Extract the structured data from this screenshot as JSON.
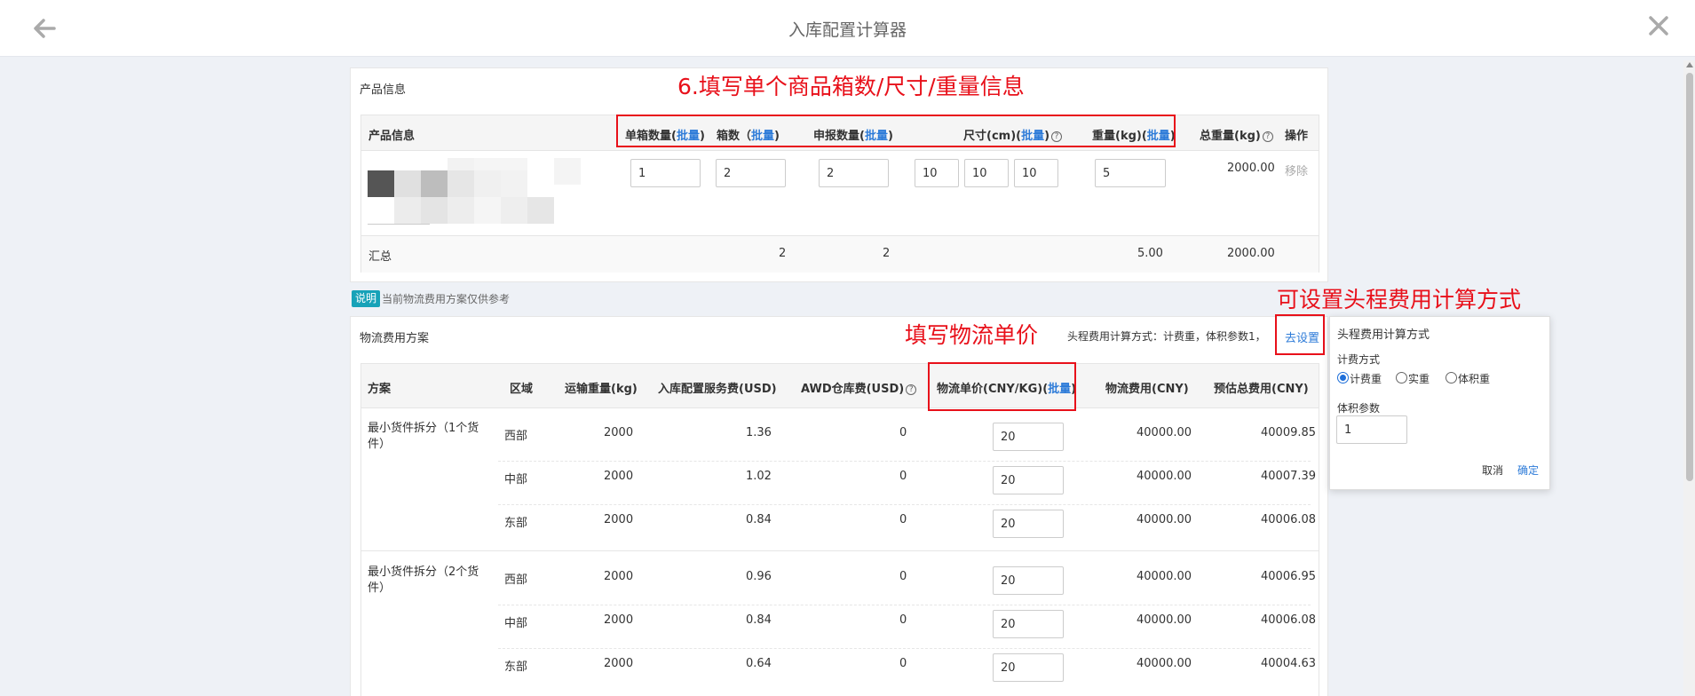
{
  "header": {
    "title": "入库配置计算器"
  },
  "product": {
    "panel_title": "产品信息",
    "columns": {
      "product_info": "产品信息",
      "per_box_qty": "单箱数量(",
      "box_count": "箱数（",
      "declared_qty": "申报数量(",
      "size": "尺寸(cm)(",
      "weight": "重量(kg)(",
      "total_weight": "总重量(kg)",
      "action": "操作",
      "batch": "批量",
      "close_paren": ")"
    },
    "row": {
      "per_box_qty": "1",
      "box_count": "2",
      "declared_qty": "2",
      "length": "10",
      "width": "10",
      "height": "10",
      "weight": "5",
      "total_weight": "2000.00",
      "remove": "移除"
    },
    "summary": {
      "label": "汇总",
      "box_count": "2",
      "declared_qty": "2",
      "weight": "5.00",
      "total_weight": "2000.00"
    }
  },
  "notice": {
    "badge": "说明",
    "text": "当前物流费用方案仅供参考"
  },
  "logistics": {
    "panel_title": "物流费用方案",
    "calc_method_text": "头程费用计算方式：计费重，体积参数1，",
    "settings_link": "去设置",
    "columns": {
      "plan": "方案",
      "region": "区域",
      "ship_weight": "运输重量(kg)",
      "service_fee": "入库配置服务费(USD)",
      "awd_fee": "AWD仓库费(USD)",
      "unit_price": "物流单价(CNY/KG)(",
      "logistics_fee": "物流费用(CNY)",
      "estimated_total": "预估总费用(CNY)",
      "batch": "批量",
      "close_paren": ")"
    },
    "groups": [
      {
        "plan_line1": "最小货件拆分（1个货",
        "plan_line2": "件）",
        "rows": [
          {
            "region": "西部",
            "weight": "2000",
            "service_fee": "1.36",
            "awd_fee": "0",
            "unit_price": "20",
            "logistics_fee": "40000.00",
            "total": "40009.85"
          },
          {
            "region": "中部",
            "weight": "2000",
            "service_fee": "1.02",
            "awd_fee": "0",
            "unit_price": "20",
            "logistics_fee": "40000.00",
            "total": "40007.39"
          },
          {
            "region": "东部",
            "weight": "2000",
            "service_fee": "0.84",
            "awd_fee": "0",
            "unit_price": "20",
            "logistics_fee": "40000.00",
            "total": "40006.08"
          }
        ]
      },
      {
        "plan_line1": "最小货件拆分（2个货",
        "plan_line2": "件）",
        "rows": [
          {
            "region": "西部",
            "weight": "2000",
            "service_fee": "0.96",
            "awd_fee": "0",
            "unit_price": "20",
            "logistics_fee": "40000.00",
            "total": "40006.95"
          },
          {
            "region": "中部",
            "weight": "2000",
            "service_fee": "0.84",
            "awd_fee": "0",
            "unit_price": "20",
            "logistics_fee": "40000.00",
            "total": "40006.08"
          },
          {
            "region": "东部",
            "weight": "2000",
            "service_fee": "0.64",
            "awd_fee": "0",
            "unit_price": "20",
            "logistics_fee": "40000.00",
            "total": "40004.63"
          }
        ]
      }
    ]
  },
  "popover": {
    "title": "头程费用计算方式",
    "method_label": "计费方式",
    "options": [
      "计费重",
      "实重",
      "体积重"
    ],
    "selected_option": "计费重",
    "volume_label": "体积参数",
    "volume_value": "1",
    "cancel": "取消",
    "confirm": "确定"
  },
  "annotations": {
    "product_info": "6.填写单个商品箱数/尺寸/重量信息",
    "calc_method": "可设置头程费用计算方式",
    "unit_price": "填写物流单价"
  },
  "colors": {
    "annotation_red": "#e8101a",
    "link_blue": "#2d7bd8",
    "badge_teal": "#17a2b8"
  }
}
